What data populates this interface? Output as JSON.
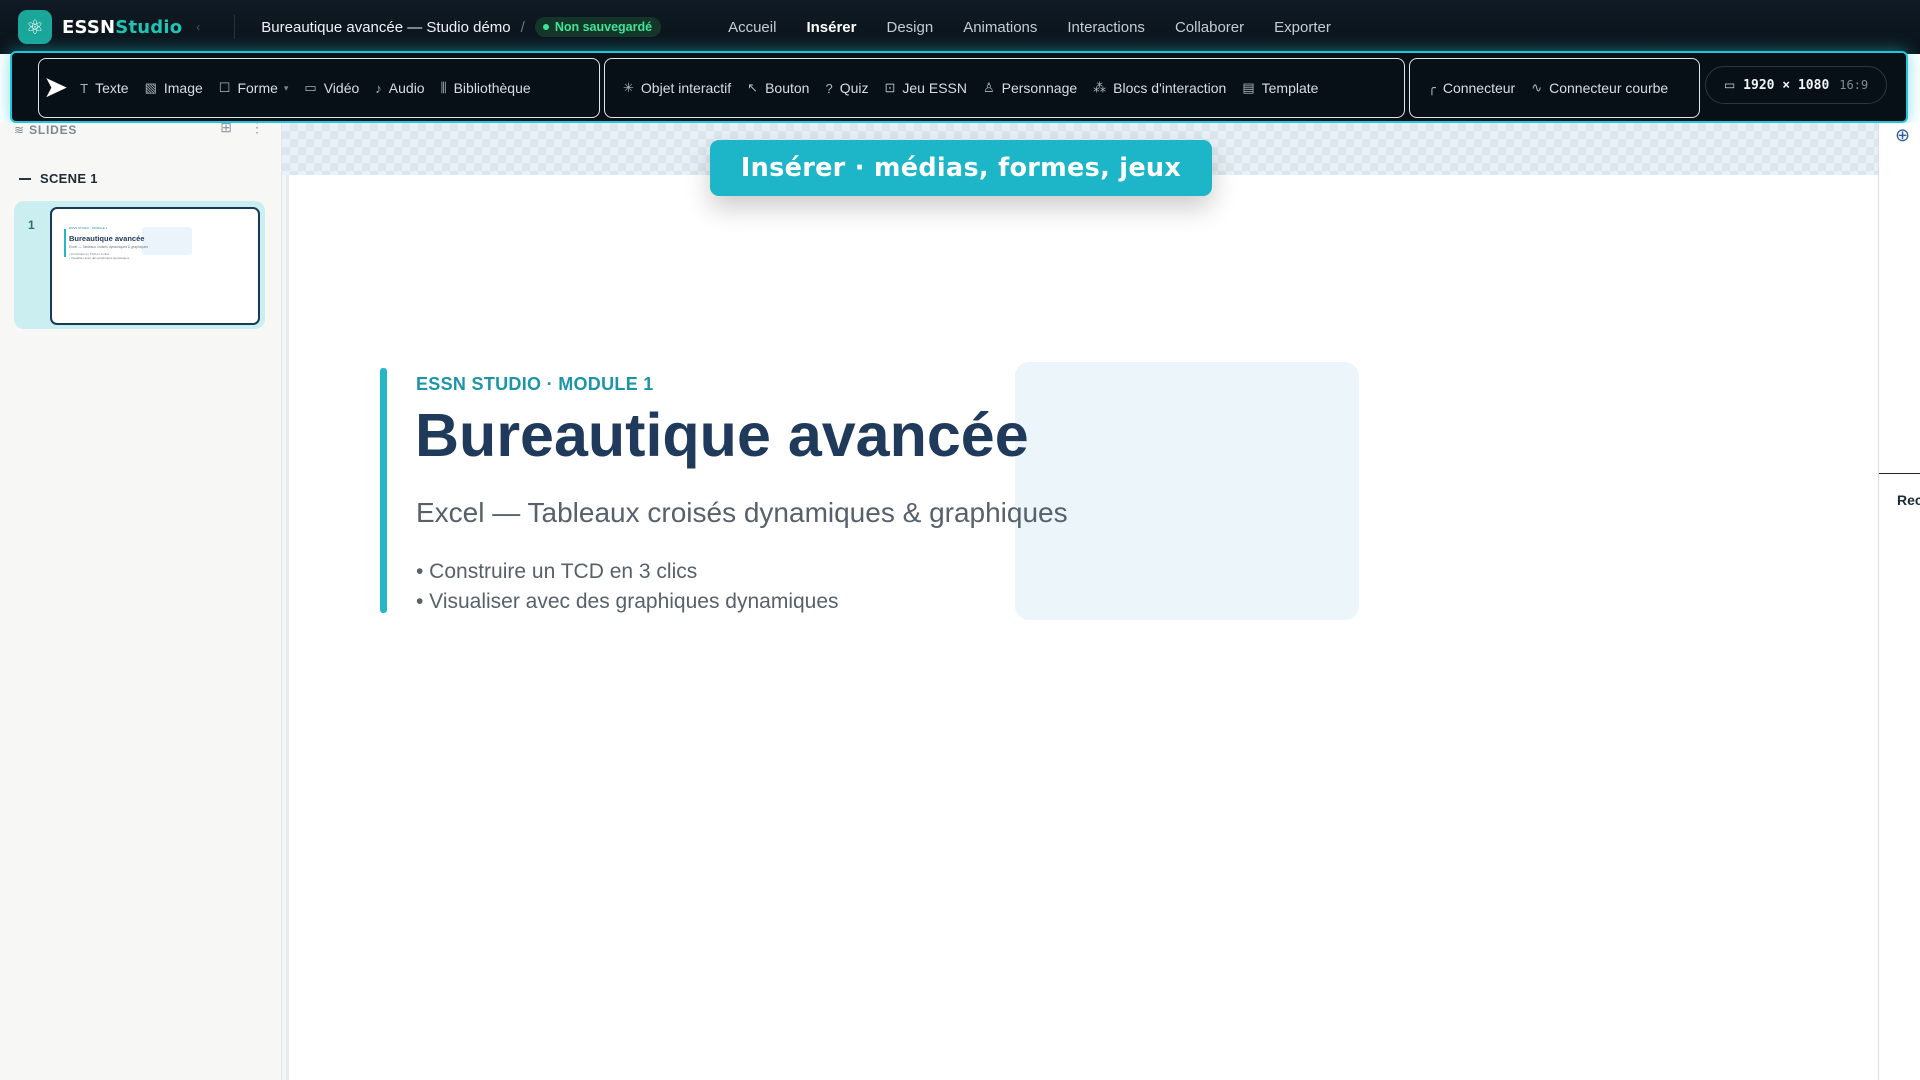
{
  "app": {
    "brand_main": "ESSN",
    "brand_accent": "Studio",
    "logo_icon": "network-icon"
  },
  "header": {
    "doc_title": "Bureautique avancée — Studio démo",
    "separator": "/",
    "status": "Non sauvegardé",
    "menu": [
      {
        "label": "Accueil",
        "active": false
      },
      {
        "label": "Insérer",
        "active": true
      },
      {
        "label": "Design",
        "active": false
      },
      {
        "label": "Animations",
        "active": false
      },
      {
        "label": "Interactions",
        "active": false
      },
      {
        "label": "Collaborer",
        "active": false
      },
      {
        "label": "Exporter",
        "active": false
      }
    ]
  },
  "ribbon": {
    "group_media": [
      {
        "label": "Texte",
        "icon": "text-icon"
      },
      {
        "label": "Image",
        "icon": "image-icon"
      },
      {
        "label": "Forme",
        "icon": "shape-icon"
      },
      {
        "label": "Vidéo",
        "icon": "video-icon"
      },
      {
        "label": "Audio",
        "icon": "microphone-icon"
      },
      {
        "label": "Bibliothèque",
        "icon": "library-icon"
      }
    ],
    "group_interactive": [
      {
        "label": "Objet interactif",
        "icon": "sparkle-icon"
      },
      {
        "label": "Bouton",
        "icon": "pointer-icon"
      },
      {
        "label": "Quiz",
        "icon": "question-icon"
      },
      {
        "label": "Jeu ESSN",
        "icon": "gamepad-icon"
      },
      {
        "label": "Personnage",
        "icon": "person-icon"
      },
      {
        "label": "Blocs d'interaction",
        "icon": "blocks-icon"
      },
      {
        "label": "Template",
        "icon": "template-icon"
      }
    ],
    "group_connectors": [
      {
        "label": "Connecteur",
        "icon": "connector-icon"
      },
      {
        "label": "Connecteur courbe",
        "icon": "curve-connector-icon"
      }
    ],
    "resolution": "1920 × 1080",
    "ratio": "16:9"
  },
  "sidebar": {
    "title": "SLIDES",
    "scene": "SCENE 1",
    "slides": [
      {
        "number": "1"
      }
    ]
  },
  "tooltip": "Insérer · médias, formes, jeux",
  "slide": {
    "kicker": "ESSN STUDIO · MODULE 1",
    "title": "Bureautique avancée",
    "subtitle": "Excel — Tableaux croisés dynamiques & graphiques",
    "bullets": [
      "• Construire un TCD en 3 clics",
      "• Visualiser avec des graphiques dynamiques"
    ]
  },
  "right_panel": {
    "label": "Rec"
  },
  "colors": {
    "accent": "#1db6c8",
    "brand": "#1aa79a",
    "title": "#203a5b",
    "status": "#3ee49a"
  }
}
